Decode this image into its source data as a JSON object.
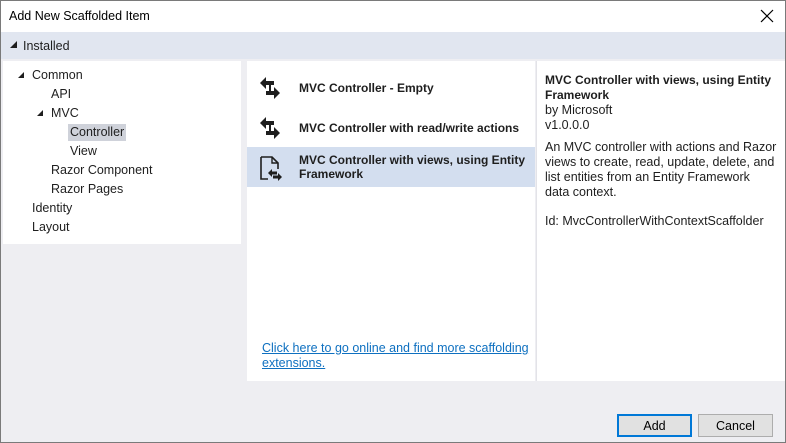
{
  "window": {
    "title": "Add New Scaffolded Item"
  },
  "installed": {
    "label": "Installed"
  },
  "tree": {
    "items": [
      {
        "label": "Common"
      },
      {
        "label": "API"
      },
      {
        "label": "MVC"
      },
      {
        "label": "Controller"
      },
      {
        "label": "View"
      },
      {
        "label": "Razor Component"
      },
      {
        "label": "Razor Pages"
      },
      {
        "label": "Identity"
      },
      {
        "label": "Layout"
      }
    ],
    "selected": "Controller"
  },
  "list": {
    "items": [
      {
        "label": "MVC Controller - Empty",
        "icon": "mvc-controller-icon"
      },
      {
        "label": "MVC Controller with read/write actions",
        "icon": "mvc-controller-icon"
      },
      {
        "label": "MVC Controller with views, using Entity Framework",
        "icon": "mvc-controller-views-icon"
      }
    ],
    "selected_index": 2,
    "online_link": "Click here to go online and find more scaffolding extensions."
  },
  "details": {
    "title": "MVC Controller with views, using Entity Framework",
    "author": "by Microsoft",
    "version": "v1.0.0.0",
    "description": "An MVC controller with actions and Razor views to create, read, update, delete, and list entities from an Entity Framework data context.",
    "id": "Id: MvcControllerWithContextScaffolder"
  },
  "buttons": {
    "add": "Add",
    "cancel": "Cancel"
  },
  "colors": {
    "accent": "#0078d7",
    "link": "#0e70c0",
    "selection": "#d3deef"
  }
}
